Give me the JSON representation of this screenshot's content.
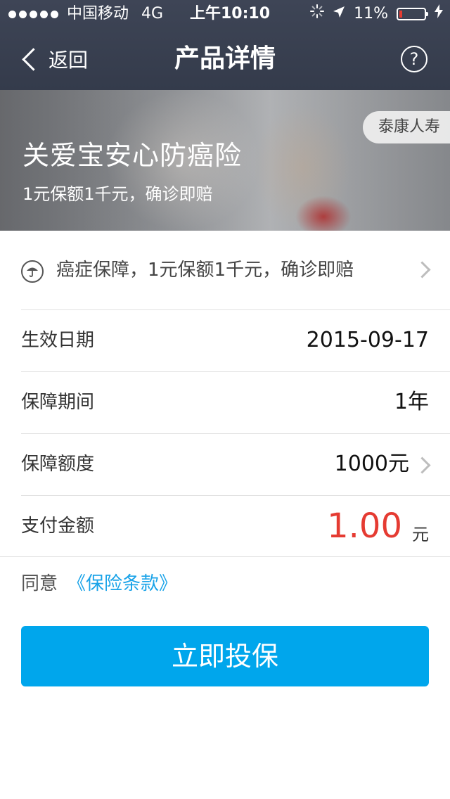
{
  "status_bar": {
    "carrier": "中国移动",
    "network": "4G",
    "time": "上午10:10",
    "battery": "11%",
    "battery_level": 0.11
  },
  "nav": {
    "back_label": "返回",
    "title": "产品详情",
    "help_label": "?"
  },
  "banner": {
    "title": "关爱宝安心防癌险",
    "subtitle": "1元保额1千元，确诊即赔",
    "insurer": "泰康人寿"
  },
  "coverage": {
    "text": "癌症保障，1元保额1千元，确诊即赔"
  },
  "details": {
    "effective_date_label": "生效日期",
    "effective_date": "2015-09-17",
    "period_label": "保障期间",
    "period": "1年",
    "amount_label": "保障额度",
    "amount": "1000元",
    "payment_label": "支付金额",
    "payment": "1.00",
    "payment_unit": "元"
  },
  "agreement": {
    "label": "同意",
    "link": "《保险条款》"
  },
  "cta": {
    "label": "立即投保"
  },
  "colors": {
    "accent": "#00a6ec",
    "price": "#e53b32",
    "link": "#1aa3e8"
  }
}
